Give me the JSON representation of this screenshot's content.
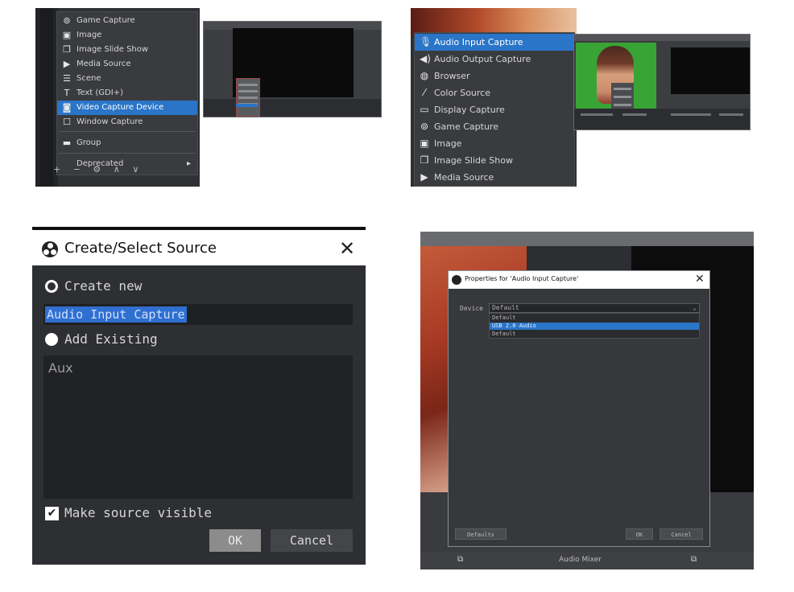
{
  "panel1": {
    "menu_items": [
      {
        "icon": "gamepad-icon",
        "glyph": "⊚",
        "label": "Game Capture",
        "selected": false
      },
      {
        "icon": "image-icon",
        "glyph": "▣",
        "label": "Image",
        "selected": false
      },
      {
        "icon": "slideshow-icon",
        "glyph": "❐",
        "label": "Image Slide Show",
        "selected": false
      },
      {
        "icon": "play-icon",
        "glyph": "▶",
        "label": "Media Source",
        "selected": false
      },
      {
        "icon": "list-icon",
        "glyph": "☰",
        "label": "Scene",
        "selected": false
      },
      {
        "icon": "text-icon",
        "glyph": "T",
        "label": "Text (GDI+)",
        "selected": false
      },
      {
        "icon": "camera-icon",
        "glyph": "◙",
        "label": "Video Capture Device",
        "selected": true
      },
      {
        "icon": "window-icon",
        "glyph": "☐",
        "label": "Window Capture",
        "selected": false
      },
      {
        "icon": "folder-icon",
        "glyph": "▬",
        "label": "Group",
        "selected": false
      },
      {
        "icon": "none",
        "glyph": "",
        "label": "Deprecated",
        "selected": false
      }
    ],
    "deprecated_arrow": "▸",
    "toolbar_glyphs": "+ − ⚙ ∧ ∨"
  },
  "panel3": {
    "menu_items": [
      {
        "icon": "microphone-icon",
        "glyph": "🎙",
        "label": "Audio Input Capture",
        "selected": true
      },
      {
        "icon": "speaker-icon",
        "glyph": "◀)",
        "label": "Audio Output Capture",
        "selected": false
      },
      {
        "icon": "globe-icon",
        "glyph": "◍",
        "label": "Browser",
        "selected": false
      },
      {
        "icon": "paintbrush-icon",
        "glyph": "⁄",
        "label": "Color Source",
        "selected": false
      },
      {
        "icon": "monitor-icon",
        "glyph": "▭",
        "label": "Display Capture",
        "selected": false
      },
      {
        "icon": "gamepad-icon",
        "glyph": "⊚",
        "label": "Game Capture",
        "selected": false
      },
      {
        "icon": "image-icon",
        "glyph": "▣",
        "label": "Image",
        "selected": false
      },
      {
        "icon": "slideshow-icon",
        "glyph": "❐",
        "label": "Image Slide Show",
        "selected": false
      },
      {
        "icon": "play-icon",
        "glyph": "▶",
        "label": "Media Source",
        "selected": false
      }
    ]
  },
  "dialog": {
    "title": "Create/Select Source",
    "close_glyph": "✕",
    "create_new_label": "Create new",
    "name_value": "Audio Input Capture",
    "add_existing_label": "Add Existing",
    "existing_items": [
      "Aux"
    ],
    "make_visible_label": "Make source visible",
    "make_visible_checked": true,
    "checkmark": "✔",
    "ok_label": "OK",
    "cancel_label": "Cancel"
  },
  "properties": {
    "title": "Properties for 'Audio Input Capture'",
    "close_glyph": "✕",
    "device_label": "Device",
    "device_value": "Default",
    "combo_arrow": "⌄",
    "dropdown_options": [
      {
        "label": "Default",
        "selected": false
      },
      {
        "label": "USB 2.0 Audio",
        "selected": true
      },
      {
        "label": "Default",
        "selected": false
      }
    ],
    "defaults_label": "Defaults",
    "ok_label": "OK",
    "cancel_label": "Cancel",
    "bottom_label": "Audio Mixer",
    "bottom_glyph_left": "⧉",
    "bottom_glyph_right": "⧉"
  },
  "colors": {
    "selection_blue": "#2a75c8",
    "panel_dark": "#2f3034",
    "green_screen": "#39a436"
  }
}
